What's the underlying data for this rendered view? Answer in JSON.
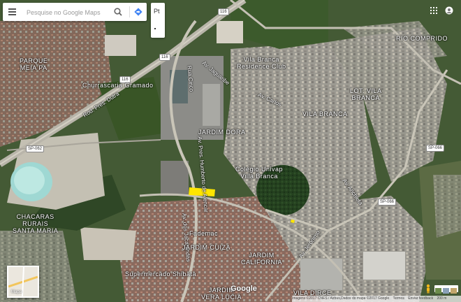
{
  "search": {
    "placeholder": "Pesquise no Google Maps",
    "menu_icon": "hamburger-menu-icon",
    "search_icon": "magnifier-icon",
    "directions_icon": "directions-diamond-icon"
  },
  "language_box": {
    "label": "Pt"
  },
  "top_right": {
    "apps_icon": "grid-apps-icon",
    "account_icon": "account-circle-icon"
  },
  "places": {
    "parque_mea_pa": "PARQUE\nMEIA PA",
    "churrascaria": "Churrascaria Gramado",
    "vila_branca_residence": "Vila Branca\nResidence Club",
    "rio_comprido": "RIO COMPRIDO",
    "lot_vila_branca": "LOT. VILA\nBRANCA",
    "vila_branca": "VILA BRANCA",
    "jardim_dora": "JARDIM DORA",
    "colegio_univap": "Colégio Univap\nVilla Branca",
    "chacaras": "CHACARAS\nRURAIS\nSANTA MARIA",
    "fademac": "Fademac",
    "jardim_cuiza": "JARDIM CUIZA",
    "jardim_california": "JARDIM\nCALIFORNIA",
    "supermercado": "Supermercado Shibata",
    "jardim_vera_lucia": "JARDIM\nVERA LUCIA",
    "vila_dirce": "VILA DIRCE"
  },
  "roads": {
    "rod_dutra": "Rod. Pres. Dutra",
    "rua_cinco": "Rua Cinco",
    "av_jaguaribe": "Av. Jaguaribe",
    "av_carlos": "Av. Carlos",
    "av_pres_dutra": "Av. Pres. Humberto de Alencar",
    "av_dos_jacarandas": "Av. dos Jacarandás",
    "av_anchieta": "Av. Anchieta",
    "av_jeronimo": "Av. Jerônimo"
  },
  "shields": {
    "br116_a": "116",
    "br116_b": "116",
    "br116_c": "116",
    "sp062_a": "SP-062",
    "sp066_a": "SP-066",
    "sp066_b": "SP-066"
  },
  "map_controls": {
    "layer_label": "Mapa",
    "google_logo": "Google",
    "footer": {
      "imagery": "Imagens ©2017 CNES / Airbus,Dados do mapa ©2017 Google",
      "terms": "Termos",
      "feedback": "Enviar feedback",
      "scale": "200 m"
    }
  },
  "colors": {
    "highlight_polygon": "#ffe600",
    "vegetation_dark": "#1f3a1f",
    "urban": "#9a9a94"
  }
}
